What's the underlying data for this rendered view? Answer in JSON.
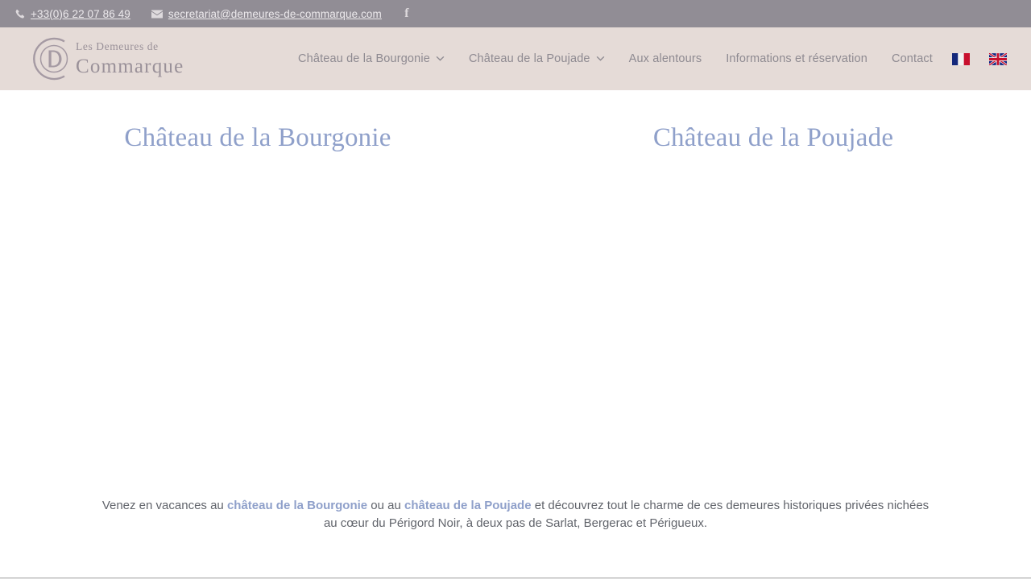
{
  "topbar": {
    "phone": "+33(0)6 22 07 86 49",
    "email": "secretariat@demeures-de-commarque.com",
    "phone_icon": "phone-icon",
    "email_icon": "envelope-icon",
    "social": [
      {
        "name": "facebook-icon",
        "glyph": "f"
      }
    ],
    "background": "#918d95",
    "text_color": "#ece9ec"
  },
  "header": {
    "background": "#e5dbd7",
    "logo": {
      "monogram": "CD",
      "line1": "Les Demeures de",
      "line2": "Commarque",
      "color": "#9a9199"
    },
    "nav": [
      {
        "label": "Château de la Bourgonie",
        "has_dropdown": true
      },
      {
        "label": "Château de la Poujade",
        "has_dropdown": true
      },
      {
        "label": "Aux alentours",
        "has_dropdown": false
      },
      {
        "label": "Informations et réservation",
        "has_dropdown": false
      },
      {
        "label": "Contact",
        "has_dropdown": false
      }
    ],
    "languages": [
      {
        "name": "flag-fr-icon",
        "label": "Français"
      },
      {
        "name": "flag-en-icon",
        "label": "English"
      }
    ],
    "nav_color": "#8e8a91"
  },
  "main": {
    "accent_color": "#8fa0ca",
    "cards": [
      {
        "title": "Château de la Bourgonie"
      },
      {
        "title": "Château de la Poujade"
      }
    ],
    "intro": {
      "part1": "Venez en vacances au ",
      "link1": "château de la Bourgonie",
      "part2": " ou au ",
      "link2": "château de la Poujade",
      "part3": " et découvrez tout le charme de ces demeures historiques privées nichées au cœur du Périgord Noir, à deux pas de Sarlat, Bergerac et Périgueux.",
      "text_color": "#61646b"
    }
  }
}
